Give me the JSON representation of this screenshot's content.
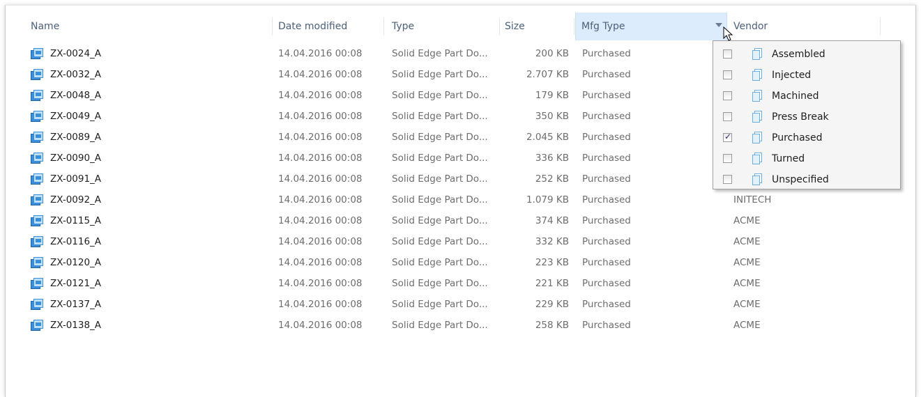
{
  "columns": {
    "name": "Name",
    "date": "Date modified",
    "type": "Type",
    "size": "Size",
    "mfg": "Mfg Type",
    "vendor": "Vendor"
  },
  "files": [
    {
      "name": "ZX-0024_A",
      "date": "14.04.2016 00:08",
      "type": "Solid Edge Part Do...",
      "size": "200 KB",
      "mfg": "Purchased",
      "vendor": ""
    },
    {
      "name": "ZX-0032_A",
      "date": "14.04.2016 00:08",
      "type": "Solid Edge Part Do...",
      "size": "2.707 KB",
      "mfg": "Purchased",
      "vendor": ""
    },
    {
      "name": "ZX-0048_A",
      "date": "14.04.2016 00:08",
      "type": "Solid Edge Part Do...",
      "size": "179 KB",
      "mfg": "Purchased",
      "vendor": ""
    },
    {
      "name": "ZX-0049_A",
      "date": "14.04.2016 00:08",
      "type": "Solid Edge Part Do...",
      "size": "350 KB",
      "mfg": "Purchased",
      "vendor": ""
    },
    {
      "name": "ZX-0089_A",
      "date": "14.04.2016 00:08",
      "type": "Solid Edge Part Do...",
      "size": "2.045 KB",
      "mfg": "Purchased",
      "vendor": ""
    },
    {
      "name": "ZX-0090_A",
      "date": "14.04.2016 00:08",
      "type": "Solid Edge Part Do...",
      "size": "336 KB",
      "mfg": "Purchased",
      "vendor": ""
    },
    {
      "name": "ZX-0091_A",
      "date": "14.04.2016 00:08",
      "type": "Solid Edge Part Do...",
      "size": "252 KB",
      "mfg": "Purchased",
      "vendor": ""
    },
    {
      "name": "ZX-0092_A",
      "date": "14.04.2016 00:08",
      "type": "Solid Edge Part Do...",
      "size": "1.079 KB",
      "mfg": "Purchased",
      "vendor": "INITECH"
    },
    {
      "name": "ZX-0115_A",
      "date": "14.04.2016 00:08",
      "type": "Solid Edge Part Do...",
      "size": "374 KB",
      "mfg": "Purchased",
      "vendor": "ACME"
    },
    {
      "name": "ZX-0116_A",
      "date": "14.04.2016 00:08",
      "type": "Solid Edge Part Do...",
      "size": "332 KB",
      "mfg": "Purchased",
      "vendor": "ACME"
    },
    {
      "name": "ZX-0120_A",
      "date": "14.04.2016 00:08",
      "type": "Solid Edge Part Do...",
      "size": "223 KB",
      "mfg": "Purchased",
      "vendor": "ACME"
    },
    {
      "name": "ZX-0121_A",
      "date": "14.04.2016 00:08",
      "type": "Solid Edge Part Do...",
      "size": "221 KB",
      "mfg": "Purchased",
      "vendor": "ACME"
    },
    {
      "name": "ZX-0137_A",
      "date": "14.04.2016 00:08",
      "type": "Solid Edge Part Do...",
      "size": "229 KB",
      "mfg": "Purchased",
      "vendor": "ACME"
    },
    {
      "name": "ZX-0138_A",
      "date": "14.04.2016 00:08",
      "type": "Solid Edge Part Do...",
      "size": "258 KB",
      "mfg": "Purchased",
      "vendor": "ACME"
    }
  ],
  "filter": {
    "options": [
      {
        "label": "Assembled",
        "checked": false
      },
      {
        "label": "Injected",
        "checked": false
      },
      {
        "label": "Machined",
        "checked": false
      },
      {
        "label": "Press Break",
        "checked": false
      },
      {
        "label": "Purchased",
        "checked": true
      },
      {
        "label": "Turned",
        "checked": false
      },
      {
        "label": "Unspecified",
        "checked": false
      }
    ]
  },
  "icons": {
    "file": "solid-edge-part-icon",
    "filter_option": "document-stack-icon",
    "cursor": "mouse-pointer-icon"
  },
  "colors": {
    "header_text": "#4c607a",
    "active_header_bg": "#dcecfc",
    "row_text": "#6d6d6d",
    "name_text": "#1e1e1e",
    "icon_blue": "#3a8fd8"
  }
}
